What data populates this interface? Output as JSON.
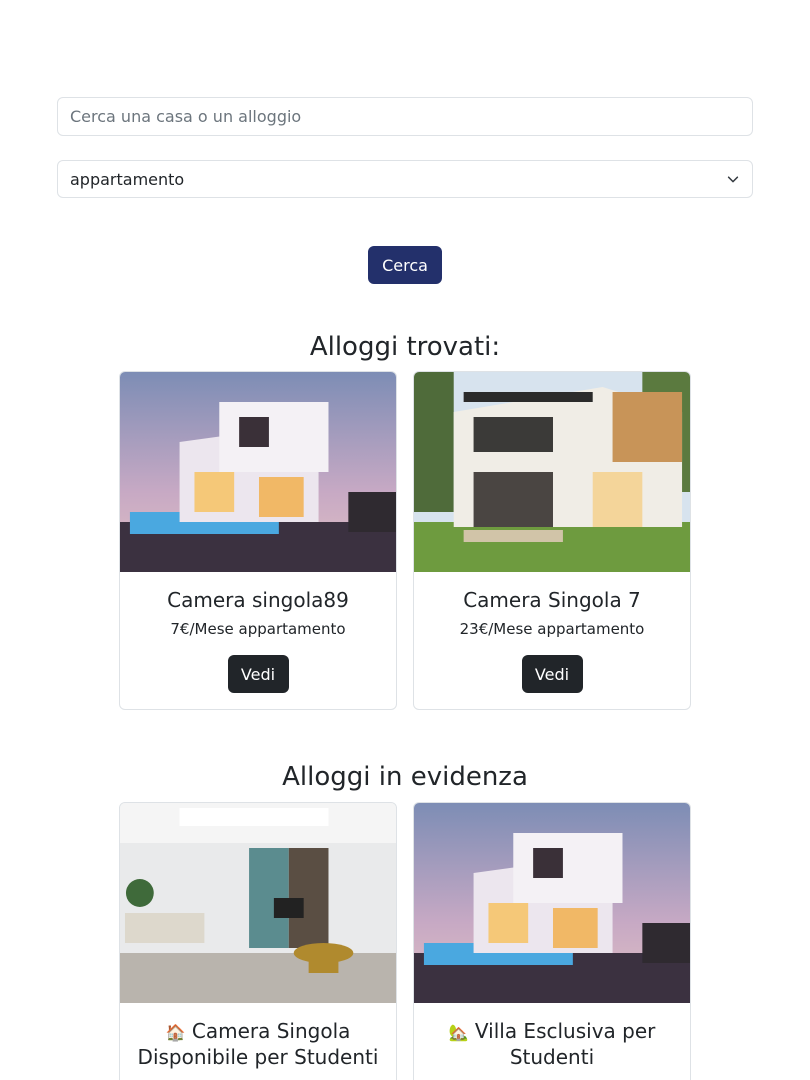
{
  "search": {
    "placeholder": "Cerca una casa o un alloggio"
  },
  "filter": {
    "selected": "appartamento"
  },
  "search_button": "Cerca",
  "found": {
    "title": "Alloggi trovati:",
    "cards": [
      {
        "title": "Camera singola89",
        "meta": "7€/Mese appartamento",
        "button": "Vedi"
      },
      {
        "title": "Camera Singola 7",
        "meta": "23€/Mese appartamento",
        "button": "Vedi"
      }
    ]
  },
  "featured": {
    "title": "Alloggi in evidenza",
    "cards": [
      {
        "title": "Camera Singola Disponibile per Studenti",
        "emoji": "🏠"
      },
      {
        "title": "Villa Esclusiva per Studenti",
        "emoji": "🏡"
      }
    ]
  },
  "colors": {
    "primary": "#23306b",
    "dark": "#212529"
  }
}
